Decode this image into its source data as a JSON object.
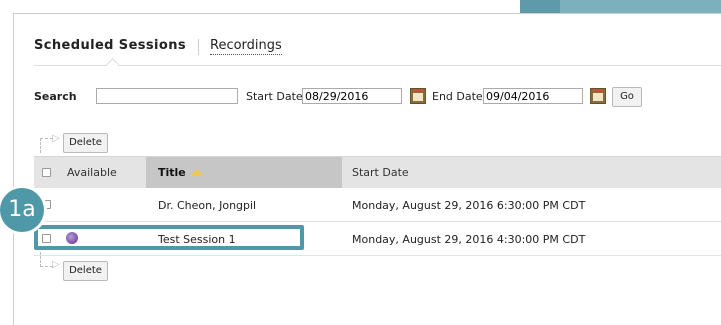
{
  "tabs": {
    "scheduled_sessions": "Scheduled Sessions",
    "recordings": "Recordings"
  },
  "search": {
    "search_label": "Search",
    "search_value": "",
    "start_date_label": "Start Date",
    "start_date_value": "08/29/2016",
    "end_date_label": "End Date",
    "end_date_value": "09/04/2016",
    "go_label": "Go"
  },
  "actions": {
    "delete_label": "Delete"
  },
  "table": {
    "columns": [
      "Available",
      "Title",
      "Start Date"
    ],
    "rows": [
      {
        "title": "Dr. Cheon, Jongpil",
        "start_date": "Monday, August 29, 2016 6:30:00 PM CDT",
        "available": false
      },
      {
        "title": "Test Session 1",
        "start_date": "Monday, August 29, 2016 4:30:00 PM CDT",
        "available": true
      }
    ]
  },
  "callout": {
    "label": "1a"
  },
  "colors": {
    "accent": "#4f98a8",
    "header_bg": "#e4e4e4",
    "sorted_header_bg": "#c6c6c6"
  },
  "icons": {
    "calendar": "calendar-icon",
    "available": "available-icon",
    "sort": "sort-ascending-icon"
  }
}
